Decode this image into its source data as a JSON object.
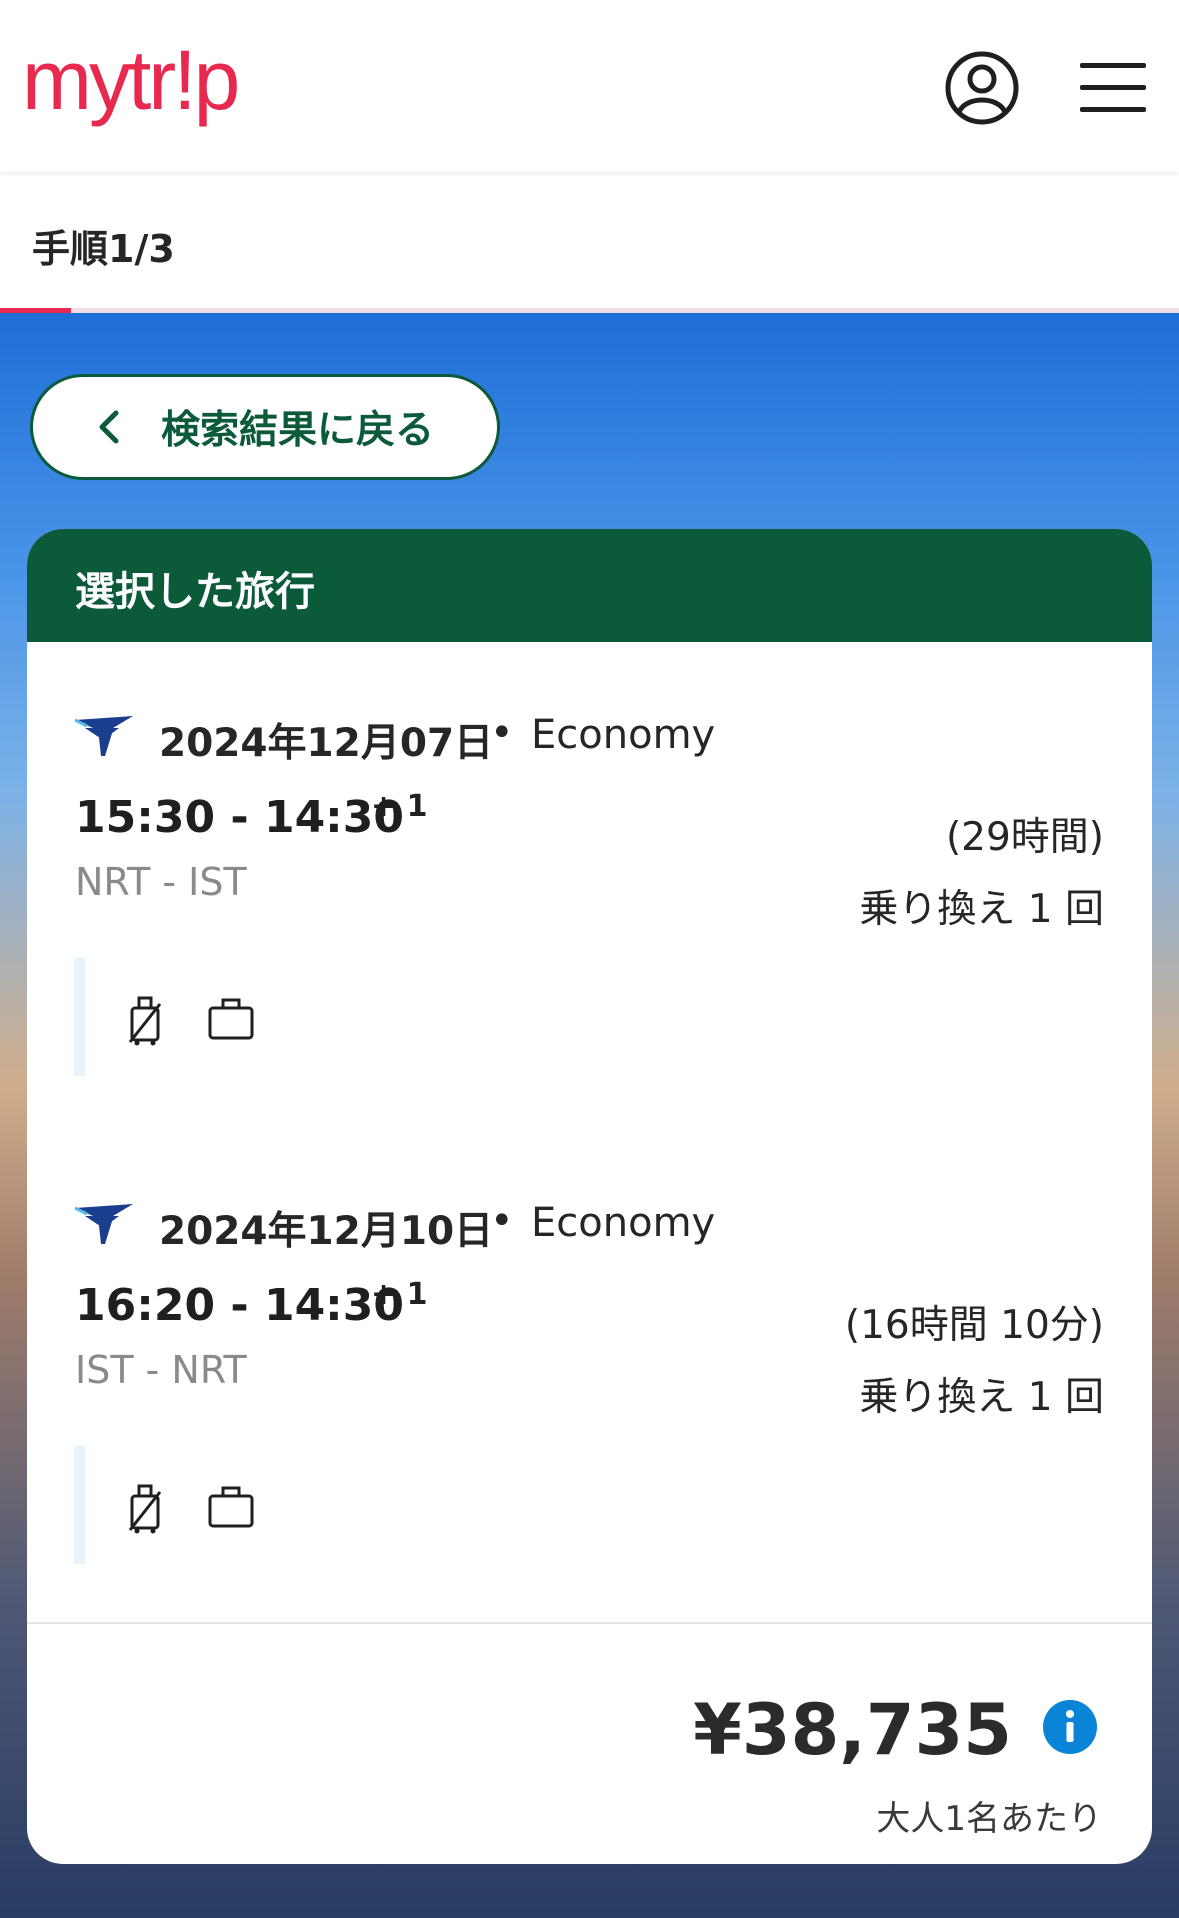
{
  "header": {
    "logo_text": "mytr!p",
    "brand_color": "#e8294f",
    "icons": [
      "user-icon",
      "menu-icon"
    ]
  },
  "progress": {
    "step_label": "手順1/3",
    "fraction": 0.06
  },
  "back_button": {
    "label": "検索結果に戻る"
  },
  "trip": {
    "title": "選択した旅行",
    "accent_color": "#0b5a3a",
    "legs": [
      {
        "date": "2024年12月07日",
        "cabin": "Economy",
        "times": "15:30 - 14:30",
        "day_offset": "+ 1",
        "route": "NRT - IST",
        "duration": "(29時間)",
        "stops": "乗り換え 1 回",
        "baggage_icons": [
          "carry-on-bag-icon",
          "checked-bag-icon"
        ]
      },
      {
        "date": "2024年12月10日",
        "cabin": "Economy",
        "times": "16:20 - 14:30",
        "day_offset": "+ 1",
        "route": "IST - NRT",
        "duration": "(16時間 10分)",
        "stops": "乗り換え 1 回",
        "baggage_icons": [
          "carry-on-bag-icon",
          "checked-bag-icon"
        ]
      }
    ]
  },
  "price": {
    "amount": "¥38,735",
    "note": "大人1名あたり"
  }
}
